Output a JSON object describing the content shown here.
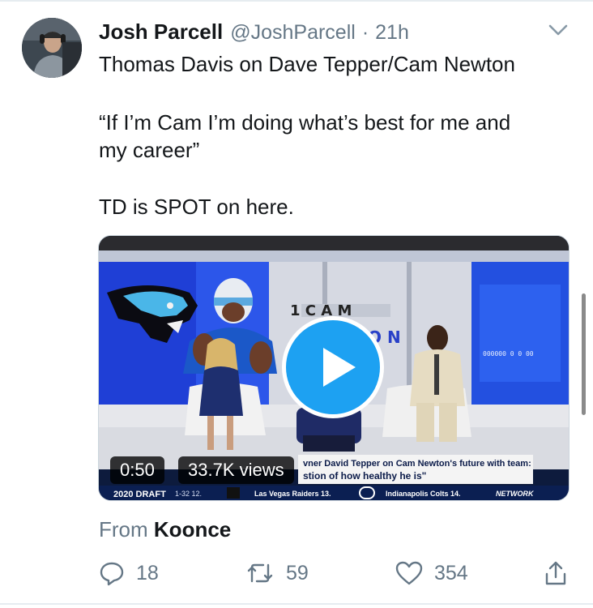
{
  "tweet": {
    "author_name": "Josh Parcell",
    "handle": "@JoshParcell",
    "separator": "·",
    "time": "21h",
    "lines": [
      "Thomas Davis on Dave Tepper/Cam Newton",
      "“If I’m Cam I’m doing what’s best for me and",
      "my career”",
      "TD is SPOT on here."
    ]
  },
  "video": {
    "duration": "0:50",
    "views": "33.7K views",
    "screen_text": {
      "set_title_1": "1 C A M",
      "set_title_2": "O N",
      "lower_third_1": "vner David Tepper on Cam Newton's future with team:",
      "lower_third_2": "stion of how healthy he is\"",
      "ticker_draft": "2020 DRAFT",
      "ticker_pick1": "1-32  12.",
      "ticker_team1": "Las Vegas Raiders  13.",
      "ticker_team2": "Indianapolis Colts  14.",
      "ticker_net": "NETWORK",
      "score_panel": "000000 0   0 00"
    }
  },
  "attribution": {
    "prefix": "From",
    "source": "Koonce"
  },
  "actions": {
    "replies": "18",
    "retweets": "59",
    "likes": "354"
  },
  "icons": {
    "caret": "chevron-down-icon",
    "reply": "reply-icon",
    "retweet": "retweet-icon",
    "like": "heart-icon",
    "share": "share-icon",
    "play": "play-icon"
  },
  "colors": {
    "accent": "#1da1f2",
    "secondary_text": "#657786",
    "primary_text": "#14171a"
  }
}
